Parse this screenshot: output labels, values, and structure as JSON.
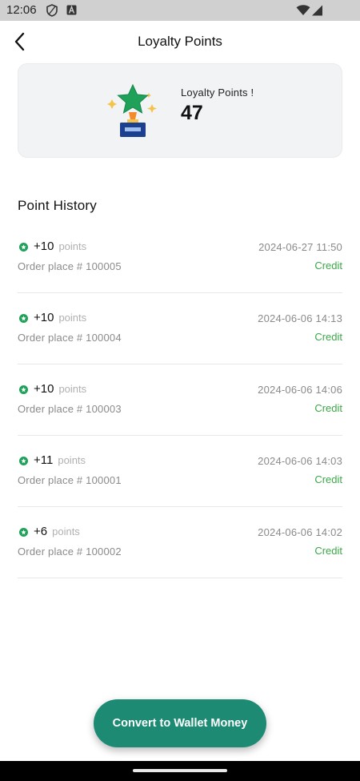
{
  "status_bar": {
    "time": "12:06",
    "icons": [
      "shield-icon",
      "a-badge-icon",
      "wifi-icon",
      "signal-icon"
    ]
  },
  "header": {
    "title": "Loyalty Points",
    "back_icon": "chevron-left-icon"
  },
  "points_card": {
    "label": "Loyalty Points !",
    "value": "47",
    "icon": "trophy-star-icon"
  },
  "history": {
    "title": "Point History",
    "unit_label": "points",
    "items": [
      {
        "amount": "+10",
        "unit": "points",
        "order": "Order place # 100005",
        "date": "2024-06-27 11:50",
        "type": "Credit"
      },
      {
        "amount": "+10",
        "unit": "points",
        "order": "Order place # 100004",
        "date": "2024-06-06 14:13",
        "type": "Credit"
      },
      {
        "amount": "+10",
        "unit": "points",
        "order": "Order place # 100003",
        "date": "2024-06-06 14:06",
        "type": "Credit"
      },
      {
        "amount": "+11",
        "unit": "points",
        "order": "Order place # 100001",
        "date": "2024-06-06 14:03",
        "type": "Credit"
      },
      {
        "amount": "+6",
        "unit": "points",
        "order": "Order place # 100002",
        "date": "2024-06-06 14:02",
        "type": "Credit"
      }
    ]
  },
  "actions": {
    "convert_label": "Convert to Wallet Money"
  },
  "colors": {
    "accent": "#1d8b73",
    "credit": "#3ba847",
    "card_bg": "#f2f3f4"
  }
}
